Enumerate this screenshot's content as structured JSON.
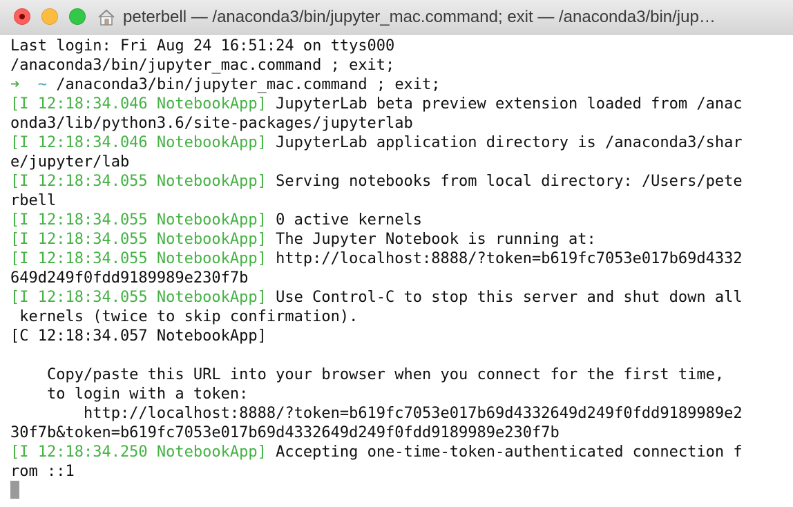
{
  "window": {
    "title": "peterbell — /anaconda3/bin/jupyter_mac.command; exit — /anaconda3/bin/jup…"
  },
  "icons": {
    "close": "close-icon",
    "minimize": "minimize-icon",
    "zoom": "zoom-icon",
    "home": "home-icon"
  },
  "colors": {
    "log_prefix": "#44b244",
    "prompt_arrow": "#4caf50",
    "prompt_tilde": "#4aa0b0",
    "text": "#111111"
  },
  "terminal": {
    "lines": [
      [
        {
          "t": "Last login: Fri Aug 24 16:51:24 on ttys000",
          "c": ""
        }
      ],
      [
        {
          "t": "/anaconda3/bin/jupyter_mac.command ; exit;",
          "c": ""
        }
      ],
      [
        {
          "t": "➜",
          "c": "arrow"
        },
        {
          "t": "  ",
          "c": ""
        },
        {
          "t": "~",
          "c": "tilde"
        },
        {
          "t": " /anaconda3/bin/jupyter_mac.command ; exit;",
          "c": ""
        }
      ],
      [
        {
          "t": "[I 12:18:34.046 NotebookApp]",
          "c": "g"
        },
        {
          "t": " JupyterLab beta preview extension loaded from /anac",
          "c": ""
        }
      ],
      [
        {
          "t": "onda3/lib/python3.6/site-packages/jupyterlab",
          "c": ""
        }
      ],
      [
        {
          "t": "[I 12:18:34.046 NotebookApp]",
          "c": "g"
        },
        {
          "t": " JupyterLab application directory is /anaconda3/shar",
          "c": ""
        }
      ],
      [
        {
          "t": "e/jupyter/lab",
          "c": ""
        }
      ],
      [
        {
          "t": "[I 12:18:34.055 NotebookApp]",
          "c": "g"
        },
        {
          "t": " Serving notebooks from local directory: /Users/pete",
          "c": ""
        }
      ],
      [
        {
          "t": "rbell",
          "c": ""
        }
      ],
      [
        {
          "t": "[I 12:18:34.055 NotebookApp]",
          "c": "g"
        },
        {
          "t": " 0 active kernels",
          "c": ""
        }
      ],
      [
        {
          "t": "[I 12:18:34.055 NotebookApp]",
          "c": "g"
        },
        {
          "t": " The Jupyter Notebook is running at:",
          "c": ""
        }
      ],
      [
        {
          "t": "[I 12:18:34.055 NotebookApp]",
          "c": "g"
        },
        {
          "t": " http://localhost:8888/?token=b619fc7053e017b69d4332",
          "c": ""
        }
      ],
      [
        {
          "t": "649d249f0fdd9189989e230f7b",
          "c": ""
        }
      ],
      [
        {
          "t": "[I 12:18:34.055 NotebookApp]",
          "c": "g"
        },
        {
          "t": " Use Control-C to stop this server and shut down all",
          "c": ""
        }
      ],
      [
        {
          "t": " kernels (twice to skip confirmation).",
          "c": ""
        }
      ],
      [
        {
          "t": "[C 12:18:34.057 NotebookApp]",
          "c": ""
        }
      ],
      [
        {
          "t": "",
          "c": ""
        }
      ],
      [
        {
          "t": "    Copy/paste this URL into your browser when you connect for the first time,",
          "c": ""
        }
      ],
      [
        {
          "t": "    to login with a token:",
          "c": ""
        }
      ],
      [
        {
          "t": "        http://localhost:8888/?token=b619fc7053e017b69d4332649d249f0fdd9189989e2",
          "c": ""
        }
      ],
      [
        {
          "t": "30f7b&token=b619fc7053e017b69d4332649d249f0fdd9189989e230f7b",
          "c": ""
        }
      ],
      [
        {
          "t": "[I 12:18:34.250 NotebookApp]",
          "c": "g"
        },
        {
          "t": " Accepting one-time-token-authenticated connection f",
          "c": ""
        }
      ],
      [
        {
          "t": "rom ::1",
          "c": ""
        }
      ]
    ]
  }
}
